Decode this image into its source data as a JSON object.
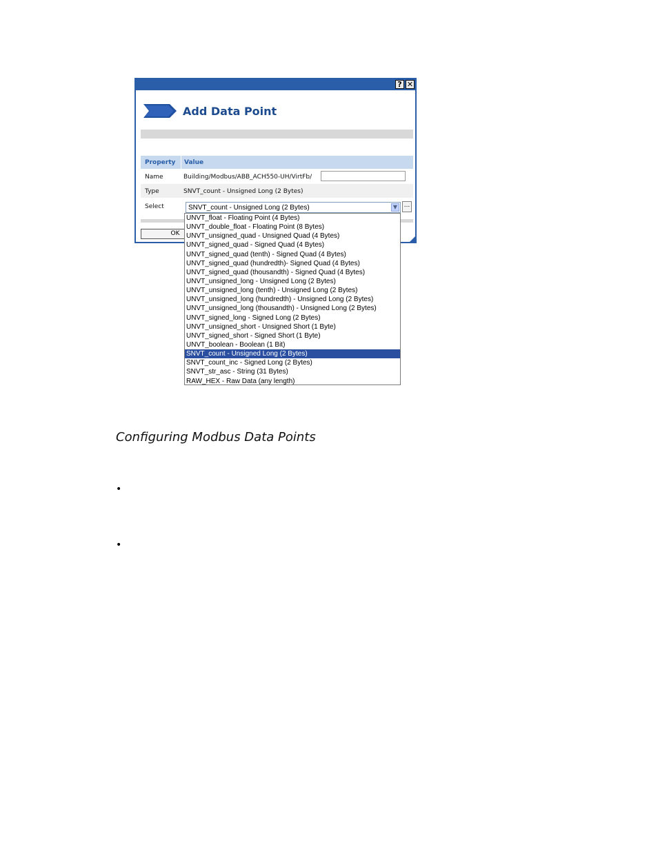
{
  "dialog": {
    "title": "Add Data Point",
    "help_icon": "question-mark-icon",
    "close_icon": "close-icon",
    "header_icon": "blue-arrow-icon",
    "colors": {
      "titlebar": "#2a5ea8",
      "title_text": "#1d4b8f",
      "table_header": "#c6d9ef",
      "selection": "#2b4fa0"
    },
    "table": {
      "header_property": "Property",
      "header_value": "Value",
      "name_label": "Name",
      "name_value": "Building/Modbus/ABB_ACH550-UH/VirtFb/",
      "name_input_value": "",
      "type_label": "Type",
      "type_value": "SNVT_count - Unsigned Long (2 Bytes)",
      "select_label": "Select",
      "select_value": "SNVT_count - Unsigned Long (2 Bytes)",
      "more_button": "..."
    },
    "ok_label": "OK"
  },
  "dropdown": {
    "items": [
      "UNVT_float - Floating Point (4 Bytes)",
      "UNVT_double_float - Floating Point (8 Bytes)",
      "UNVT_unsigned_quad - Unsigned Quad (4 Bytes)",
      "UNVT_signed_quad - Signed Quad (4 Bytes)",
      "UNVT_signed_quad (tenth) - Signed Quad (4 Bytes)",
      "UNVT_signed_quad (hundredth)- Signed Quad (4 Bytes)",
      "UNVT_signed_quad (thousandth) - Signed Quad (4 Bytes)",
      "UNVT_unsigned_long - Unsigned Long (2 Bytes)",
      "UNVT_unsigned_long (tenth) - Unsigned Long (2 Bytes)",
      "UNVT_unsigned_long (hundredth) - Unsigned Long (2 Bytes)",
      "UNVT_unsigned_long (thousandth) - Unsigned Long (2 Bytes)",
      "UNVT_signed_long - Signed Long (2 Bytes)",
      "UNVT_unsigned_short - Unsigned Short (1 Byte)",
      "UNVT_signed_short - Signed Short (1 Byte)",
      "UNVT_boolean - Boolean (1 Bit)",
      "SNVT_count - Unsigned Long (2 Bytes)",
      "SNVT_count_inc - Signed Long (2 Bytes)",
      "SNVT_str_asc - String (31 Bytes)",
      "RAW_HEX - Raw Data (any length)"
    ],
    "selected_index": 15
  },
  "document": {
    "caption": "Configuring Modbus Data Points",
    "bullet_symbol": "•"
  }
}
